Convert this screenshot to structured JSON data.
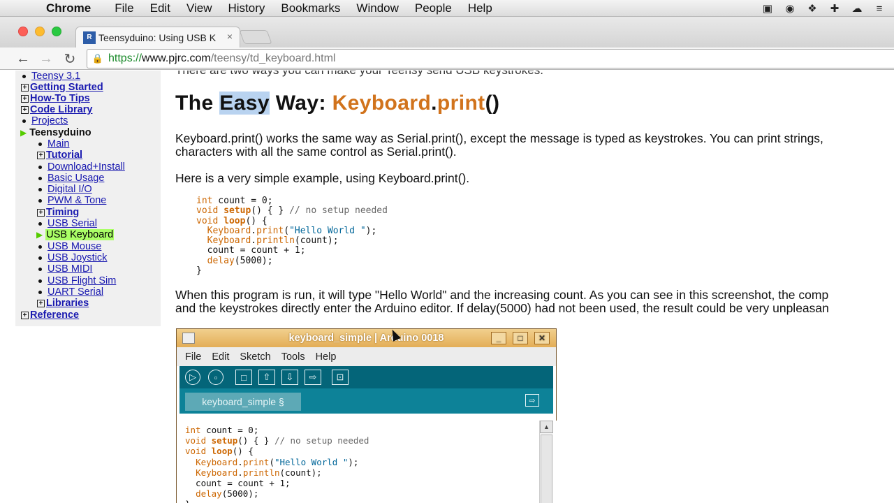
{
  "menubar": {
    "app": "Chrome",
    "items": [
      "File",
      "Edit",
      "View",
      "History",
      "Bookmarks",
      "Window",
      "People",
      "Help"
    ]
  },
  "browser": {
    "tab_title": "Teensyduino: Using USB K",
    "tab_close": "×",
    "url_scheme": "https://",
    "url_host": "www.pjrc.com",
    "url_path": "/teensy/td_keyboard.html"
  },
  "sidebar": {
    "items": [
      {
        "label": "Teensy 3.1"
      },
      {
        "label": "Getting Started"
      },
      {
        "label": "How-To Tips"
      },
      {
        "label": "Code Library"
      },
      {
        "label": "Projects"
      },
      {
        "label": "Teensyduino"
      },
      {
        "label": "Main"
      },
      {
        "label": "Tutorial"
      },
      {
        "label": "Download+Install"
      },
      {
        "label": "Basic Usage"
      },
      {
        "label": "Digital I/O"
      },
      {
        "label": "PWM & Tone"
      },
      {
        "label": "Timing"
      },
      {
        "label": "USB Serial"
      },
      {
        "label": "USB Keyboard"
      },
      {
        "label": "USB Mouse"
      },
      {
        "label": "USB Joystick"
      },
      {
        "label": "USB MIDI"
      },
      {
        "label": "USB Flight Sim"
      },
      {
        "label": "UART Serial"
      },
      {
        "label": "Libraries"
      },
      {
        "label": "Reference"
      }
    ]
  },
  "content": {
    "cut_line": "There are two ways you can make your Teensy send USB keystrokes.",
    "title_the": "The ",
    "title_easy": "Easy",
    "title_way": " Way: ",
    "title_keyboard": "Keyboard",
    "title_dot": ".",
    "title_print": "print",
    "title_parens": "()",
    "para1_line1": "Keyboard.print() works the same way as Serial.print(), except the message is typed as keystrokes. You can print strings,",
    "para1_line2": "characters with all the same control as Serial.print().",
    "para2": "Here is a very simple example, using Keyboard.print().",
    "para3_line1": "When this program is run, it will type \"Hello World\" and the increasing count. As you can see in this screenshot, the comp",
    "para3_line2": "and the keystrokes directly enter the Arduino editor. If delay(5000) had not been used, the result could be very unpleasan"
  },
  "arduino": {
    "title": "keyboard_simple | Arduino 0018",
    "menu": [
      "File",
      "Edit",
      "Sketch",
      "Tools",
      "Help"
    ],
    "tab": "keyboard_simple §"
  }
}
